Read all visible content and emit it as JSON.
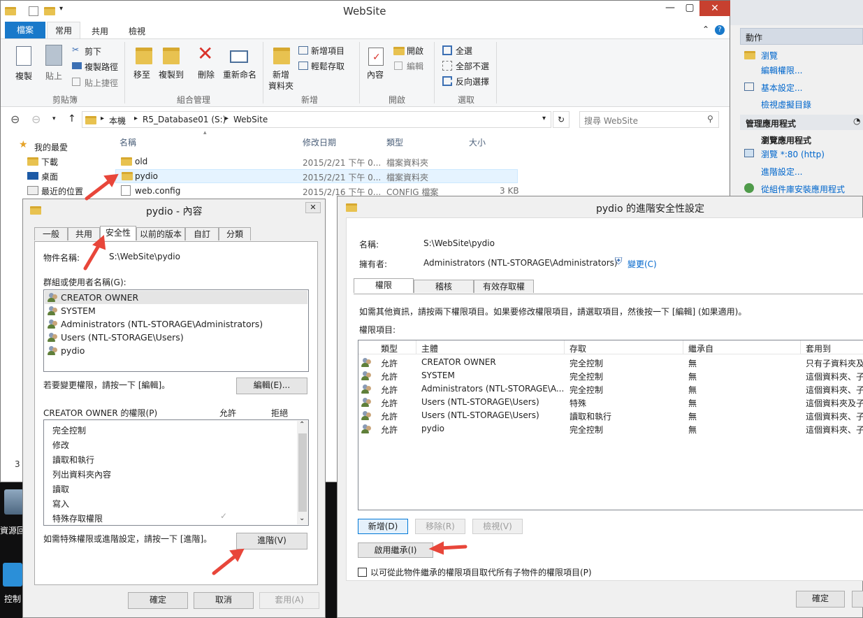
{
  "explorer": {
    "title": "WebSite",
    "ribbon_tabs": [
      "檔案",
      "常用",
      "共用",
      "檢視"
    ],
    "groups": {
      "clipboard": {
        "label": "剪貼簿",
        "copy": "複製",
        "paste": "貼上",
        "cut": "剪下",
        "copy_path": "複製路徑",
        "paste_shortcut": "貼上捷徑"
      },
      "organize": {
        "label": "組合管理",
        "move_to": "移至",
        "copy_to": "複製到",
        "delete": "刪除",
        "rename": "重新命名"
      },
      "new": {
        "label": "新增",
        "new_folder_1": "新增",
        "new_folder_2": "資料夾",
        "new_item": "新增項目",
        "easy_access": "輕鬆存取"
      },
      "open": {
        "label": "開啟",
        "properties": "內容",
        "open": "開啟",
        "edit": "編輯"
      },
      "select": {
        "label": "選取",
        "select_all": "全選",
        "select_none": "全部不選",
        "invert": "反向選擇"
      }
    },
    "breadcrumb": [
      "本機",
      "R5_Database01 (S:)",
      "WebSite"
    ],
    "search_placeholder": "搜尋 WebSite",
    "nav": [
      "我的最愛",
      "下載",
      "桌面",
      "最近的位置"
    ],
    "columns": [
      "名稱",
      "修改日期",
      "類型",
      "大小"
    ],
    "files": [
      {
        "name": "old",
        "date": "2015/2/21 下午 0...",
        "type": "檔案資料夾",
        "size": ""
      },
      {
        "name": "pydio",
        "date": "2015/2/21 下午 0...",
        "type": "檔案資料夾",
        "size": ""
      },
      {
        "name": "web.config",
        "date": "2015/2/16 下午 0...",
        "type": "CONFIG 檔案",
        "size": "3 KB"
      }
    ],
    "status_count": "3"
  },
  "iis": {
    "actions_header": "動作",
    "browse": "瀏覽",
    "edit_permissions": "編輯權限...",
    "basic_settings": "基本設定...",
    "view_vdirs": "檢視虛擬目錄",
    "manage_app": "管理應用程式",
    "browse_app": "瀏覽應用程式",
    "browse_port": "瀏覽 *:80 (http)",
    "advanced": "進階設定...",
    "install_gallery": "從組件庫安裝應用程式"
  },
  "desktop": {
    "recycle": "資源回",
    "control": "控制"
  },
  "props": {
    "title": "pydio - 內容",
    "tabs": [
      "一般",
      "共用",
      "安全性",
      "以前的版本",
      "自訂",
      "分類"
    ],
    "object_label": "物件名稱:",
    "object_value": "S:\\WebSite\\pydio",
    "groups_label": "群組或使用者名稱(G):",
    "users": [
      "CREATOR OWNER",
      "SYSTEM",
      "Administrators (NTL-STORAGE\\Administrators)",
      "Users (NTL-STORAGE\\Users)",
      "pydio"
    ],
    "change_hint": "若要變更權限，請按一下 [編輯]。",
    "edit_btn": "編輯(E)...",
    "perm_label": "CREATOR OWNER 的權限(P)",
    "allow": "允許",
    "deny": "拒絕",
    "perms": [
      "完全控制",
      "修改",
      "讀取和執行",
      "列出資料夾內容",
      "讀取",
      "寫入",
      "特殊存取權限"
    ],
    "advanced_hint": "如需特殊權限或進階設定，請按一下 [進階]。",
    "advanced_btn": "進階(V)",
    "ok": "確定",
    "cancel": "取消",
    "apply": "套用(A)",
    "check": "✓"
  },
  "adv": {
    "title": "pydio 的進階安全性設定",
    "name_label": "名稱:",
    "name_value": "S:\\WebSite\\pydio",
    "owner_label": "擁有者:",
    "owner_value": "Administrators (NTL-STORAGE\\Administrators)",
    "change_link": "變更(C)",
    "tabs": [
      "權限",
      "稽核",
      "有效存取權"
    ],
    "info": "如需其他資訊，請按兩下權限項目。如果要修改權限項目，請選取項目，然後按一下 [編輯] (如果適用)。",
    "entries_label": "權限項目:",
    "columns": [
      "類型",
      "主體",
      "存取",
      "繼承自",
      "套用到"
    ],
    "rows": [
      {
        "type": "允許",
        "principal": "CREATOR OWNER",
        "access": "完全控制",
        "inherit": "無",
        "apply": "只有子資料夾及"
      },
      {
        "type": "允許",
        "principal": "SYSTEM",
        "access": "完全控制",
        "inherit": "無",
        "apply": "這個資料夾、子"
      },
      {
        "type": "允許",
        "principal": "Administrators (NTL-STORAGE\\A...",
        "access": "完全控制",
        "inherit": "無",
        "apply": "這個資料夾、子"
      },
      {
        "type": "允許",
        "principal": "Users (NTL-STORAGE\\Users)",
        "access": "特殊",
        "inherit": "無",
        "apply": "這個資料夾及子"
      },
      {
        "type": "允許",
        "principal": "Users (NTL-STORAGE\\Users)",
        "access": "讀取和執行",
        "inherit": "無",
        "apply": "這個資料夾、子"
      },
      {
        "type": "允許",
        "principal": "pydio",
        "access": "完全控制",
        "inherit": "無",
        "apply": "這個資料夾、子"
      }
    ],
    "add": "新增(D)",
    "remove": "移除(R)",
    "view": "檢視(V)",
    "enable_inherit": "啟用繼承(I)",
    "replace_child": "以可從此物件繼承的權限項目取代所有子物件的權限項目(P)",
    "ok": "確定"
  },
  "colors": {
    "accent": "#1979ca",
    "arrow": "#e8463a",
    "selected": "#cce8ff",
    "link": "#0066cc"
  }
}
